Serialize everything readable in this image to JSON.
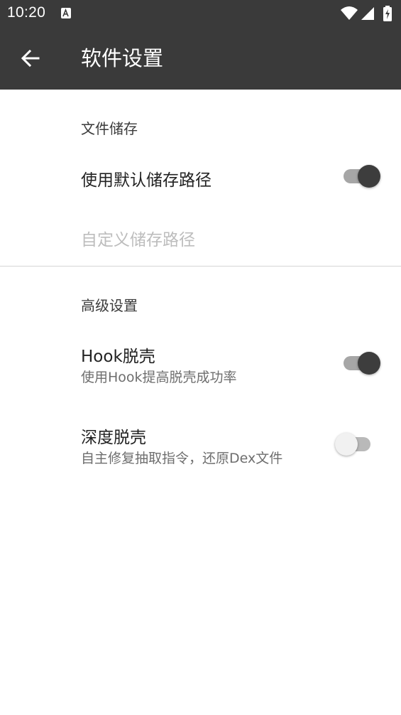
{
  "status_bar": {
    "time": "10:20",
    "notification_icon": "a-box-icon",
    "icons": [
      "wifi-icon",
      "signal-icon",
      "battery-charging-icon"
    ]
  },
  "appbar": {
    "back_icon": "arrow-left-icon",
    "title": "软件设置"
  },
  "sections": {
    "storage": {
      "header": "文件储存",
      "use_default_path": {
        "title": "使用默认储存路径",
        "enabled": true
      },
      "custom_path": {
        "title": "自定义储存路径",
        "disabled": true
      }
    },
    "advanced": {
      "header": "高级设置",
      "hook_unpack": {
        "title": "Hook脱壳",
        "summary": "使用Hook提高脱壳成功率",
        "enabled": true
      },
      "deep_unpack": {
        "title": "深度脱壳",
        "summary": "自主修复抽取指令，还原Dex文件",
        "enabled": false
      }
    }
  },
  "colors": {
    "appbar": "#3a3a3a",
    "switch_on_thumb": "#3d3d3d",
    "switch_off_thumb": "#f1f1f1",
    "disabled_text": "#bdbdbd"
  }
}
